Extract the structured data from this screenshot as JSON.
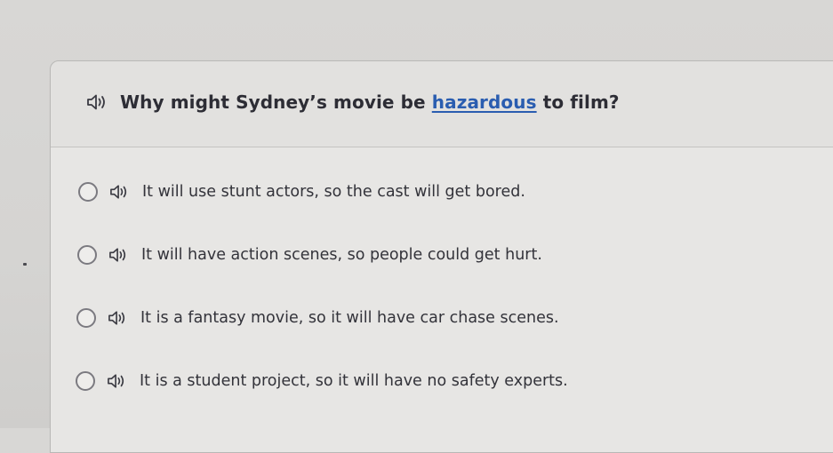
{
  "question": {
    "before": "Why might Sydney’s movie be ",
    "vocab_word": "hazardous",
    "after": " to film?",
    "speaker_icon": "speaker-icon"
  },
  "options": [
    {
      "text": "It will use stunt actors, so the cast will get bored."
    },
    {
      "text": "It will have action scenes, so people could get hurt."
    },
    {
      "text": "It is a fantasy movie, so it will have car chase scenes."
    },
    {
      "text": "It is a student project, so it will have no safety experts."
    }
  ],
  "colors": {
    "vocab_link": "#2a5db0",
    "text": "#2d2d35",
    "radio_border": "#7b7a80"
  }
}
